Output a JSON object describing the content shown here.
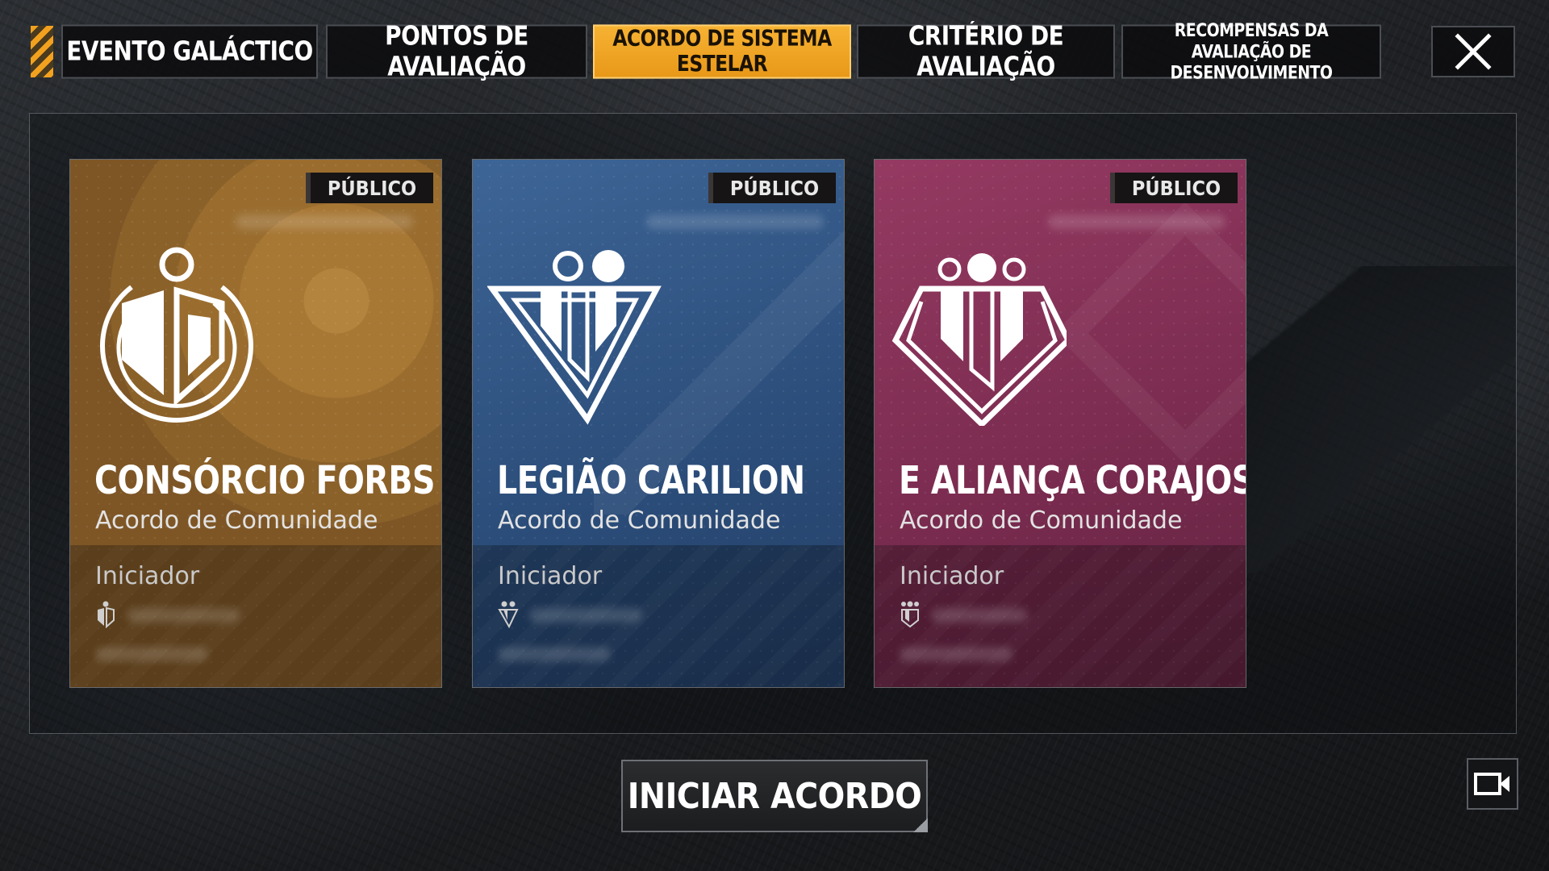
{
  "tabs": [
    {
      "label": "EVENTO GALÁCTICO",
      "active": false
    },
    {
      "label": "PONTOS DE AVALIAÇÃO",
      "active": false
    },
    {
      "label": "ACORDO DE SISTEMA ESTELAR",
      "active": true
    },
    {
      "label": "CRITÉRIO DE AVALIAÇÃO",
      "active": false
    },
    {
      "label": "RECOMPENSAS DA AVALIAÇÃO DE DESENVOLVIMENTO",
      "active": false
    }
  ],
  "colors": {
    "accent": "#f2a11e",
    "card_gold": "#9a6d2f",
    "card_blue": "#2c4e7b",
    "card_magenta": "#7b2c50"
  },
  "cards": [
    {
      "badge": "PÚBLICO",
      "title": "CONSÓRCIO FORBS",
      "subtitle": "Acordo de Comunidade",
      "initiator_label": "Iniciador",
      "emblem": "forbs-emblem-icon"
    },
    {
      "badge": "PÚBLICO",
      "title": "LEGIÃO CARILION",
      "subtitle": "Acordo de Comunidade",
      "initiator_label": "Iniciador",
      "emblem": "carilion-emblem-icon"
    },
    {
      "badge": "PÚBLICO",
      "title": "E ALIANÇA CORAJOSA",
      "subtitle": "Acordo de Comunidade",
      "initiator_label": "Iniciador",
      "emblem": "corajosa-emblem-icon"
    }
  ],
  "start_button": "INICIAR ACORDO"
}
